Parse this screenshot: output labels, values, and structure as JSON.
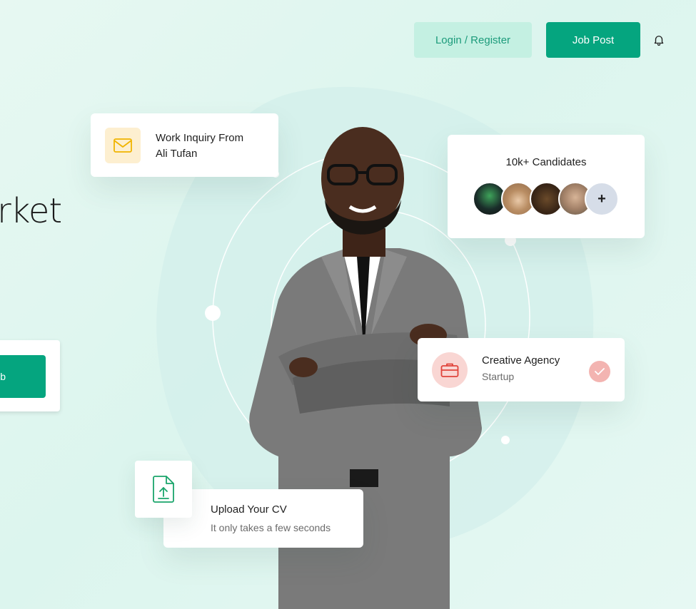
{
  "header": {
    "login_label": "Login / Register",
    "jobpost_label": "Job Post",
    "bell_icon": "bell-icon"
  },
  "hero": {
    "partial_heading": "rket",
    "partial_button": "ob"
  },
  "cards": {
    "inquiry": {
      "icon": "mail-icon",
      "line1": "Work Inquiry From",
      "line2": "Ali Tufan"
    },
    "candidates": {
      "title": "10k+ Candidates",
      "more_label": "+",
      "avatar_count": 4
    },
    "agency": {
      "icon": "briefcase-icon",
      "title": "Creative Agency",
      "subtitle": "Startup",
      "status_icon": "check-icon"
    },
    "upload": {
      "icon": "file-upload-icon",
      "title": "Upload Your CV",
      "subtitle": "It only takes a few seconds"
    }
  },
  "colors": {
    "primary": "#05a57f",
    "primary_light": "#c4f0e2",
    "mail_badge": "#fdefd0",
    "mail_icon": "#f0b400",
    "brief_badge": "#f9d6d3",
    "brief_icon": "#e0443b",
    "background": "#e7f8f2"
  }
}
